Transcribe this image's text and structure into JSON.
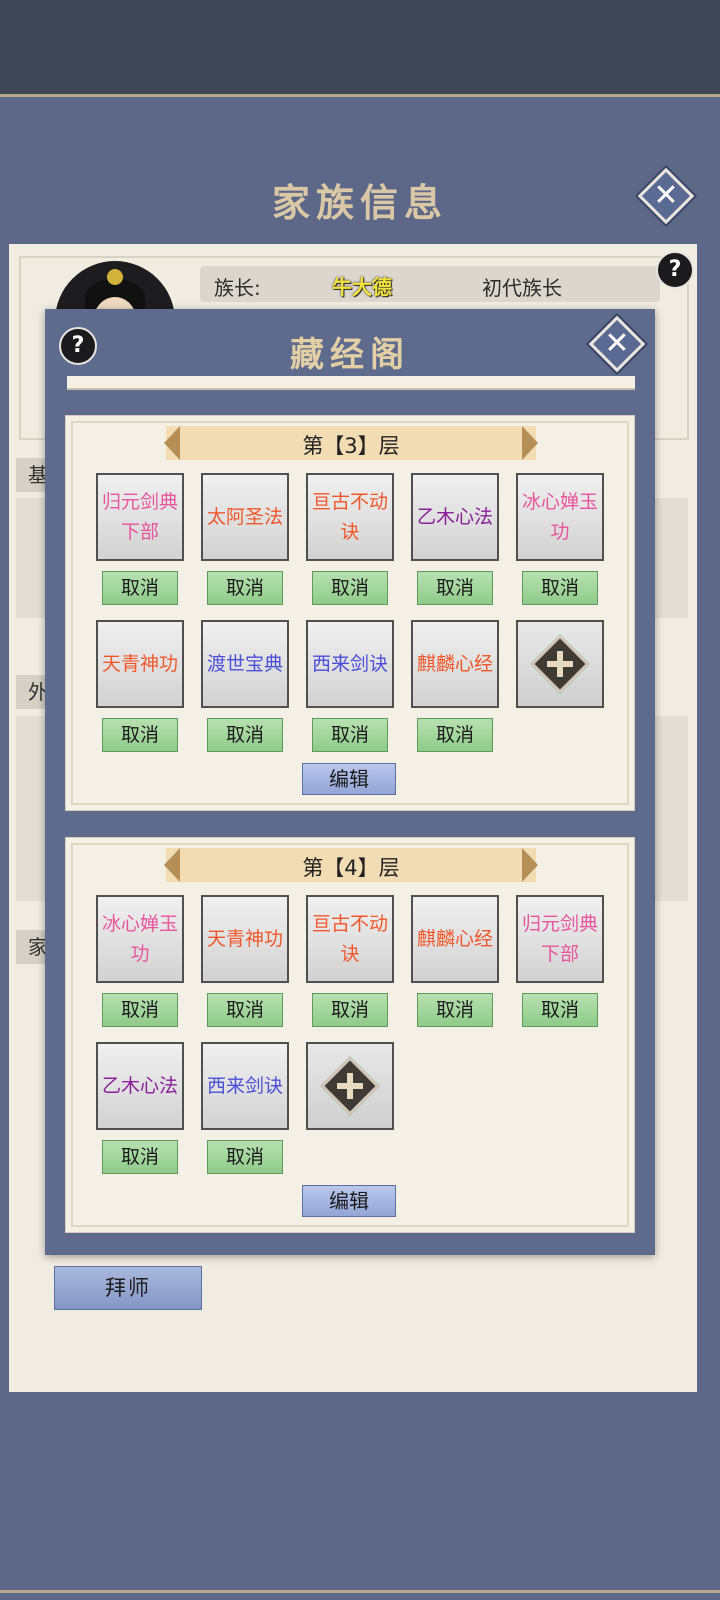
{
  "family": {
    "title": "家族信息",
    "leader_label": "族长:",
    "leader_name": "牛大德",
    "leader_title": "初代族长",
    "tab_1": "基",
    "tab_2": "外",
    "tab_3": "家",
    "apprentice_label": "拜师"
  },
  "library": {
    "title": "藏经阁",
    "floors": [
      {
        "label": "第【3】层",
        "books": [
          {
            "name": "归元剑典下部",
            "color": "#e8559b"
          },
          {
            "name": "太阿圣法",
            "color": "#f0582b"
          },
          {
            "name": "亘古不动诀",
            "color": "#f0582b"
          },
          {
            "name": "乙木心法",
            "color": "#8a1f99"
          },
          {
            "name": "冰心婵玉功",
            "color": "#e8559b"
          },
          {
            "name": "天青神功",
            "color": "#f0582b"
          },
          {
            "name": "渡世宝典",
            "color": "#4b4fd7"
          },
          {
            "name": "西来剑诀",
            "color": "#4b4fd7"
          },
          {
            "name": "麒麟心经",
            "color": "#f0582b"
          }
        ],
        "cancel_label": "取消",
        "edit_label": "编辑"
      },
      {
        "label": "第【4】层",
        "books": [
          {
            "name": "冰心婵玉功",
            "color": "#e8559b"
          },
          {
            "name": "天青神功",
            "color": "#f0582b"
          },
          {
            "name": "亘古不动诀",
            "color": "#f0582b"
          },
          {
            "name": "麒麟心经",
            "color": "#f0582b"
          },
          {
            "name": "归元剑典下部",
            "color": "#e8559b"
          },
          {
            "name": "乙木心法",
            "color": "#8a1f99"
          },
          {
            "name": "西来剑诀",
            "color": "#4b4fd7"
          }
        ],
        "cancel_label": "取消",
        "edit_label": "编辑"
      }
    ]
  },
  "icons": {
    "close": "close-icon",
    "help": "help-icon",
    "add": "add-icon"
  }
}
